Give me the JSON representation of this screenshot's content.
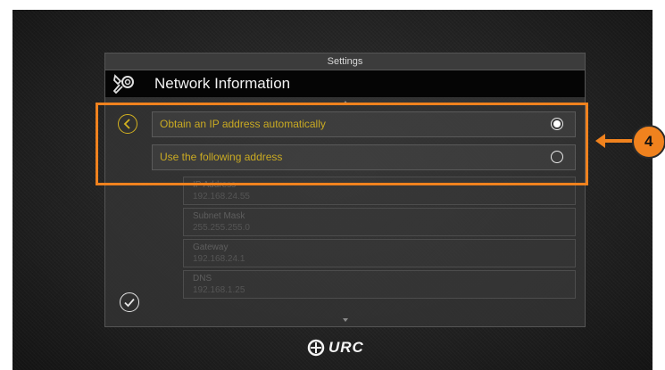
{
  "window": {
    "title": "Settings"
  },
  "header": {
    "title": "Network Information",
    "icon": "wrench-icon"
  },
  "options": [
    {
      "label": "Obtain an IP address automatically",
      "selected": true
    },
    {
      "label": "Use the following address",
      "selected": false
    }
  ],
  "fields": [
    {
      "label": "IP Address",
      "value": "192.168.24.55"
    },
    {
      "label": "Subnet Mask",
      "value": "255.255.255.0"
    },
    {
      "label": "Gateway",
      "value": "192.168.24.1"
    },
    {
      "label": "DNS",
      "value": "192.168.1.25"
    }
  ],
  "callout": {
    "number": "4",
    "color": "#f0821e"
  },
  "footer": {
    "logo_text": "URC"
  },
  "colors": {
    "accent": "#c9aa22",
    "highlight": "#f0821e"
  }
}
